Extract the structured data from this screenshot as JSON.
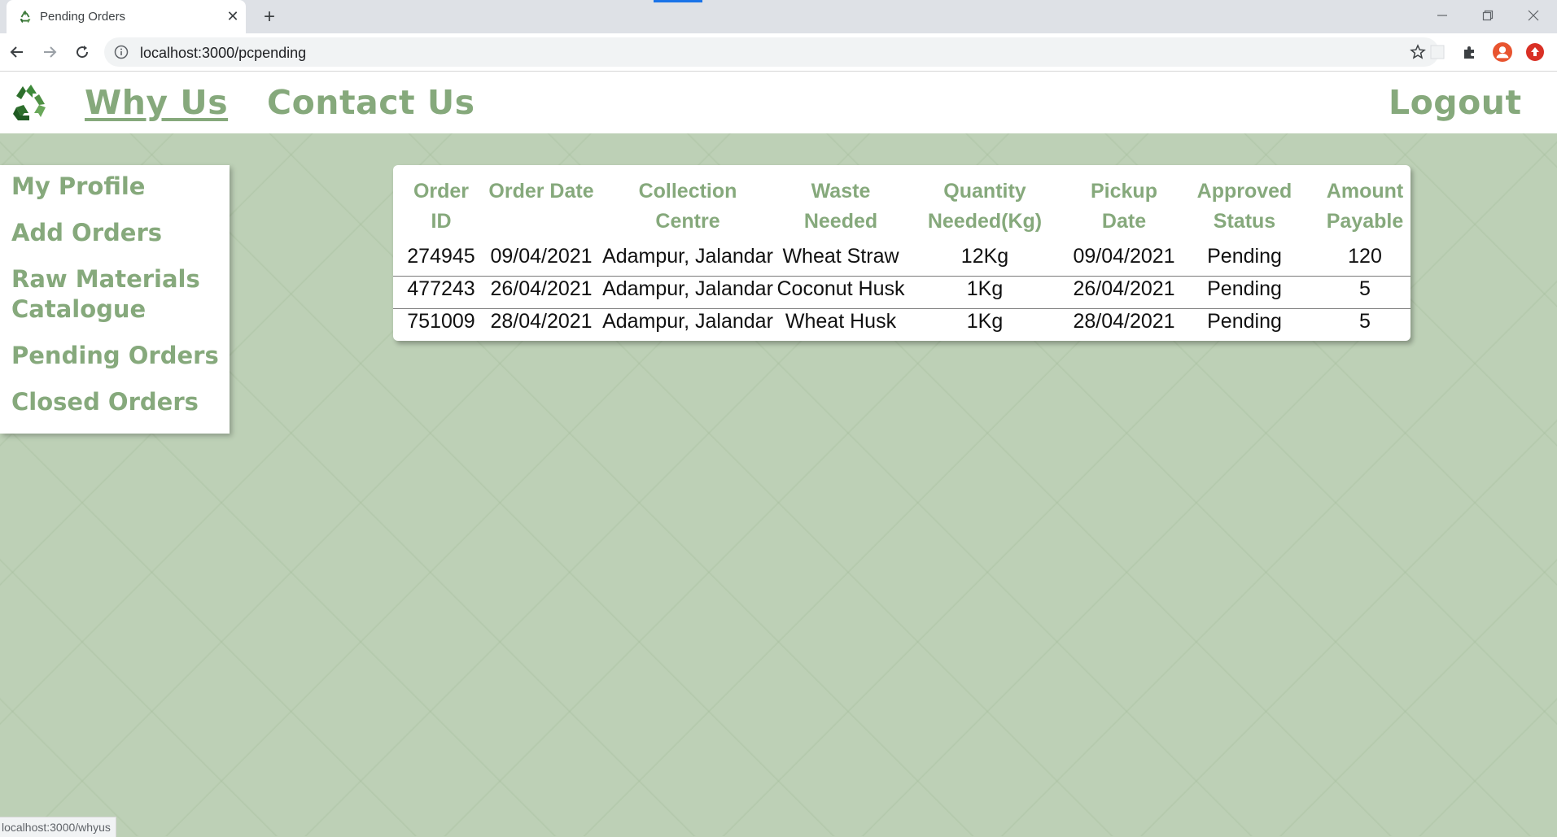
{
  "browser": {
    "tab_title": "Pending Orders",
    "new_tab_symbol": "+",
    "close_tab_symbol": "✕",
    "url": "localhost:3000/pcpending",
    "status_url": "localhost:3000/whyus",
    "window_controls": [
      "minimize",
      "restore",
      "close"
    ]
  },
  "header": {
    "nav": {
      "why_us": "Why Us",
      "contact_us": "Contact Us",
      "logout": "Logout"
    },
    "logo_icon": "recycle-icon"
  },
  "sidebar": {
    "items": [
      {
        "label": "My Profile"
      },
      {
        "label": "Add Orders"
      },
      {
        "label": "Raw Materials Catalogue"
      },
      {
        "label": "Pending Orders"
      },
      {
        "label": "Closed Orders"
      }
    ]
  },
  "orders_table": {
    "columns": [
      "Order ID",
      "Order Date",
      "Collection Centre",
      "Waste Needed",
      "Quantity Needed(Kg)",
      "Pickup Date",
      "Approved Status",
      "Amount Payable"
    ],
    "rows": [
      [
        "274945",
        "09/04/2021",
        "Adampur, Jalandar",
        "Wheat Straw",
        "12Kg",
        "09/04/2021",
        "Pending",
        "120"
      ],
      [
        "477243",
        "26/04/2021",
        "Adampur, Jalandar",
        "Coconut Husk",
        "1Kg",
        "26/04/2021",
        "Pending",
        "5"
      ],
      [
        "751009",
        "28/04/2021",
        "Adampur, Jalandar",
        "Wheat Husk",
        "1Kg",
        "28/04/2021",
        "Pending",
        "5"
      ]
    ]
  },
  "colors": {
    "accent_green": "#86a97c",
    "page_background": "#bdd0b6"
  }
}
